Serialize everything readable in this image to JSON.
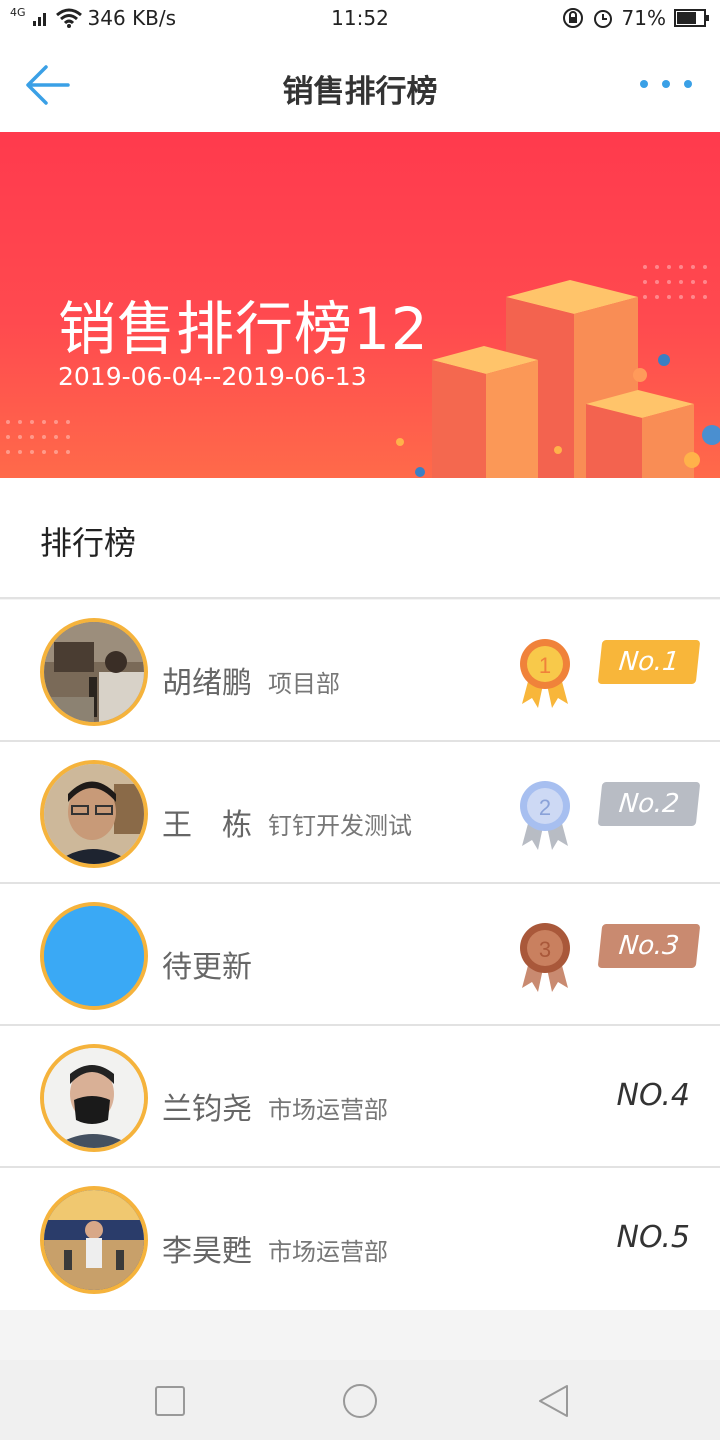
{
  "status_bar": {
    "network_type": "4G",
    "speed": "346 KB/s",
    "time": "11:52",
    "battery": "71%"
  },
  "nav": {
    "title": "销售排行榜",
    "back_icon": "arrow-left-icon",
    "more_icon": "more-dots-icon"
  },
  "banner": {
    "title": "销售排行榜12",
    "date_range": "2019-06-04--2019-06-13"
  },
  "section": {
    "label": "排行榜"
  },
  "rankings": [
    {
      "name": "胡绪鹏",
      "dept": "项目部",
      "rank_label": "No.1",
      "medal_number": "1"
    },
    {
      "name": "王　栋",
      "dept": "钉钉开发测试",
      "rank_label": "No.2",
      "medal_number": "2"
    },
    {
      "name": "待更新",
      "dept": "",
      "rank_label": "No.3",
      "medal_number": "3"
    },
    {
      "name": "兰钧尧",
      "dept": "市场运营部",
      "rank_label": "NO.4"
    },
    {
      "name": "李昊甦",
      "dept": "市场运营部",
      "rank_label": "NO.5"
    }
  ],
  "colors": {
    "accent_blue": "#3aa0e6",
    "banner_red": "#ff4050",
    "gold": "#f8b63a",
    "silver": "#b8bcc4",
    "bronze": "#c98a70",
    "avatar_border": "#f5b33c",
    "placeholder_avatar": "#3aa9f5"
  }
}
